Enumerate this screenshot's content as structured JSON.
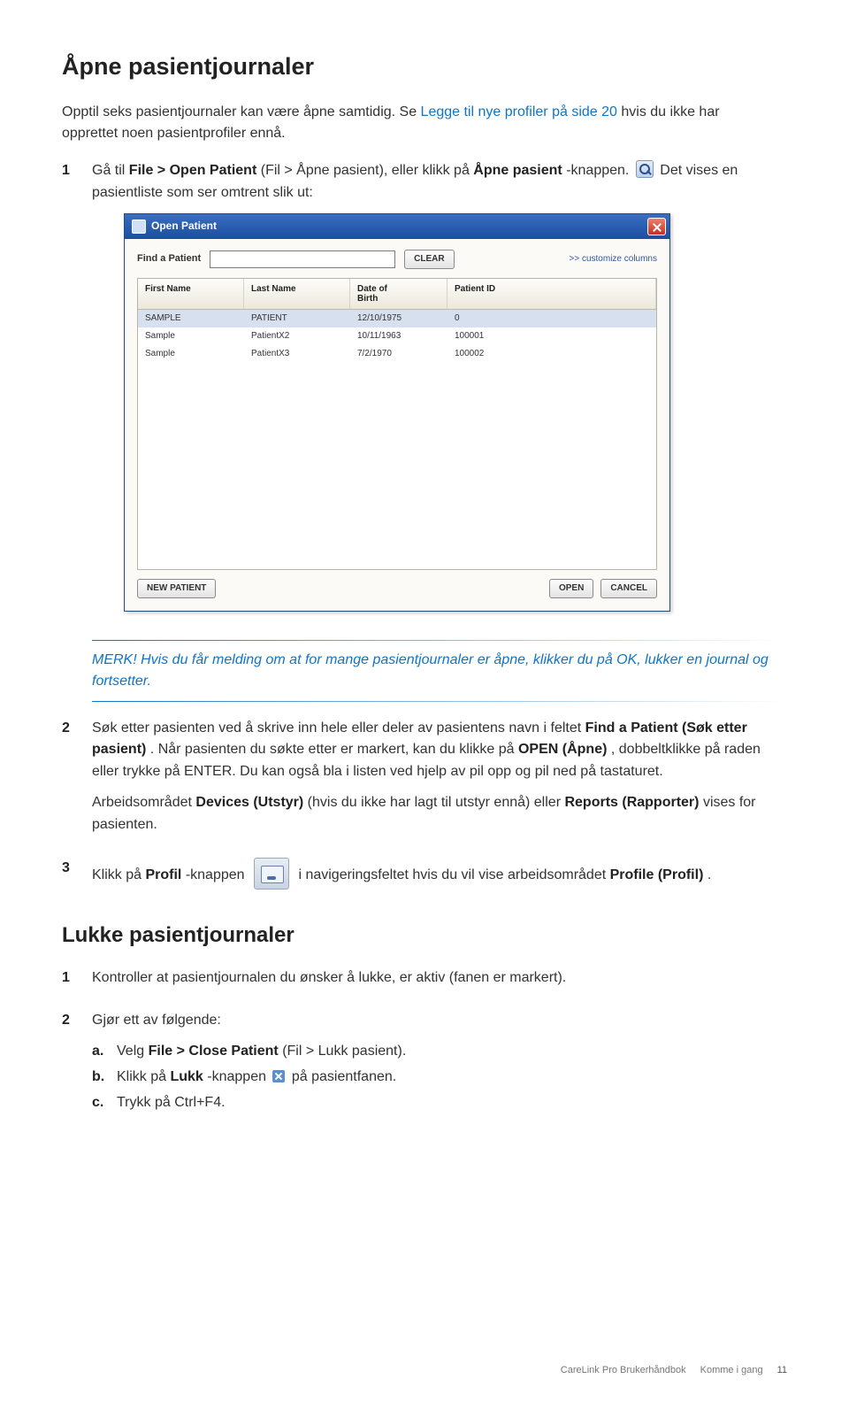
{
  "heading1": "Åpne pasientjournaler",
  "intro_pre": "Opptil seks pasientjournaler kan være åpne samtidig. Se ",
  "intro_link": "Legge til nye profiler på side 20",
  "intro_post": " hvis du ikke har opprettet noen pasientprofiler ennå.",
  "step1": {
    "a": "Gå til ",
    "b": "File > Open Patient",
    "c": " (Fil > Åpne pasient), eller klikk på ",
    "d": "Åpne pasient",
    "e": "-knappen. ",
    "f": " Det vises en pasientliste som ser omtrent slik ut:"
  },
  "dialog": {
    "title": "Open Patient",
    "find_label": "Find a Patient",
    "clear": "CLEAR",
    "customize": ">> customize columns",
    "headers": {
      "first": "First Name",
      "last": "Last Name",
      "dob": "Date of\nBirth",
      "pid": "Patient ID"
    },
    "rows": [
      {
        "first": "SAMPLE",
        "last": "PATIENT",
        "dob": "12/10/1975",
        "pid": "0",
        "selected": true
      },
      {
        "first": "Sample",
        "last": "PatientX2",
        "dob": "10/11/1963",
        "pid": "100001",
        "selected": false
      },
      {
        "first": "Sample",
        "last": "PatientX3",
        "dob": "7/2/1970",
        "pid": "100002",
        "selected": false
      }
    ],
    "new_patient": "NEW PATIENT",
    "open": "OPEN",
    "cancel": "CANCEL"
  },
  "note": "MERK! Hvis du får melding om at for mange pasientjournaler er åpne, klikker du på OK, lukker en journal og fortsetter.",
  "step2": {
    "p1a": "Søk etter pasienten ved å skrive inn hele eller deler av pasientens navn i feltet ",
    "p1b": "Find a Patient (Søk etter pasient)",
    "p1c": ". Når pasienten du søkte etter er markert, kan du klikke på ",
    "p1d": "OPEN (Åpne)",
    "p1e": ", dobbeltklikke på raden eller trykke på ENTER. Du kan også bla i listen ved hjelp av pil opp og pil ned på tastaturet.",
    "p2a": "Arbeidsområdet ",
    "p2b": "Devices (Utstyr)",
    "p2c": " (hvis du ikke har lagt til utstyr ennå) eller ",
    "p2d": "Reports (Rapporter)",
    "p2e": " vises for pasienten."
  },
  "step3": {
    "a": "Klikk på ",
    "b": "Profil",
    "c": "-knappen ",
    "d": " i navigeringsfeltet hvis du vil vise arbeidsområdet ",
    "e": "Profile (Profil)",
    "f": "."
  },
  "heading2": "Lukke pasientjournaler",
  "close_step1": "Kontroller at pasientjournalen du ønsker å lukke, er aktiv (fanen er markert).",
  "close_step2": "Gjør ett av følgende:",
  "close_a_pre": "Velg ",
  "close_a_bold": "File > Close Patient",
  "close_a_post": " (Fil > Lukk pasient).",
  "close_b_pre": "Klikk på ",
  "close_b_bold": "Lukk",
  "close_b_mid": "-knappen ",
  "close_b_post": " på pasientfanen.",
  "close_c": "Trykk på Ctrl+F4.",
  "footer": {
    "book": "CareLink Pro Brukerhåndbok",
    "section": "Komme i gang",
    "page": "11"
  }
}
